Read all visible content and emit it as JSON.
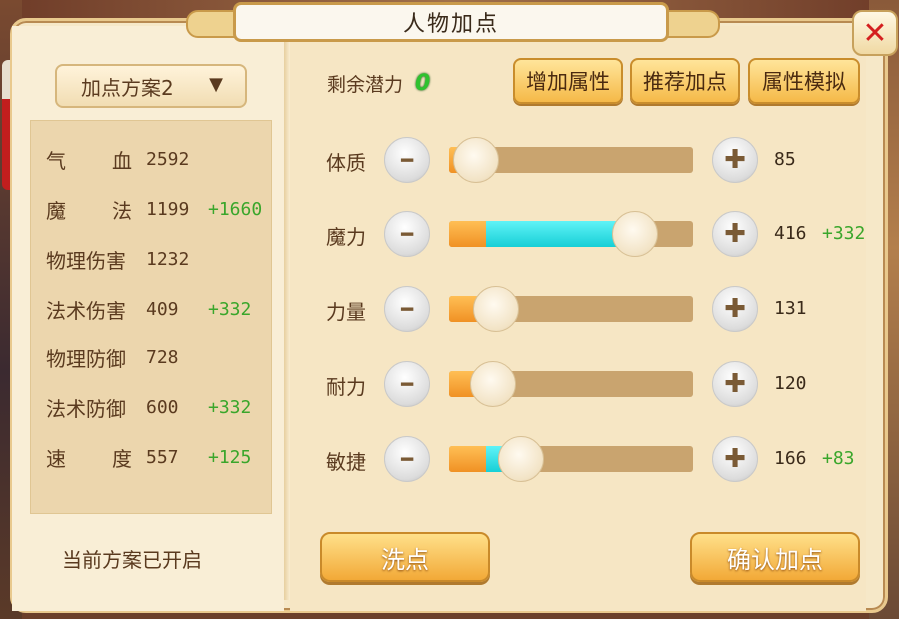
{
  "window": {
    "title": "人物加点",
    "close_icon": "close-icon"
  },
  "left_panel": {
    "plan_dropdown_label": "加点方案2",
    "stats": [
      {
        "name": "气血",
        "value": "2592",
        "bonus": ""
      },
      {
        "name": "魔法",
        "value": "1199",
        "bonus": "+1660"
      },
      {
        "name": "物理伤害",
        "value": "1232",
        "bonus": ""
      },
      {
        "name": "法术伤害",
        "value": "409",
        "bonus": "+332"
      },
      {
        "name": "物理防御",
        "value": "728",
        "bonus": ""
      },
      {
        "name": "法术防御",
        "value": "600",
        "bonus": "+332"
      },
      {
        "name": "速度",
        "value": "557",
        "bonus": "+125"
      }
    ],
    "plan_status": "当前方案已开启"
  },
  "right_panel": {
    "remaining_label": "剩余潜力",
    "remaining_value": "0",
    "buttons": {
      "add_attribute": "增加属性",
      "recommend": "推荐加点",
      "simulate": "属性模拟"
    },
    "attributes": [
      {
        "name": "体质",
        "value": "85",
        "bonus": "",
        "base_fill": 0.05,
        "bonus_fill": 0.0
      },
      {
        "name": "魔力",
        "value": "416",
        "bonus": "+332",
        "base_fill": 0.15,
        "bonus_fill": 0.55
      },
      {
        "name": "力量",
        "value": "131",
        "bonus": "",
        "base_fill": 0.13,
        "bonus_fill": 0.0
      },
      {
        "name": "耐力",
        "value": "120",
        "bonus": "",
        "base_fill": 0.12,
        "bonus_fill": 0.0
      },
      {
        "name": "敏捷",
        "value": "166",
        "bonus": "+83",
        "base_fill": 0.15,
        "bonus_fill": 0.08
      }
    ],
    "wash_button": "洗点",
    "confirm_button": "确认加点"
  },
  "colors": {
    "bonus_green": "#3aa62b",
    "bonus_fill": "#17cfd6",
    "base_fill": "#f09124",
    "close_red": "#d41f1f"
  }
}
